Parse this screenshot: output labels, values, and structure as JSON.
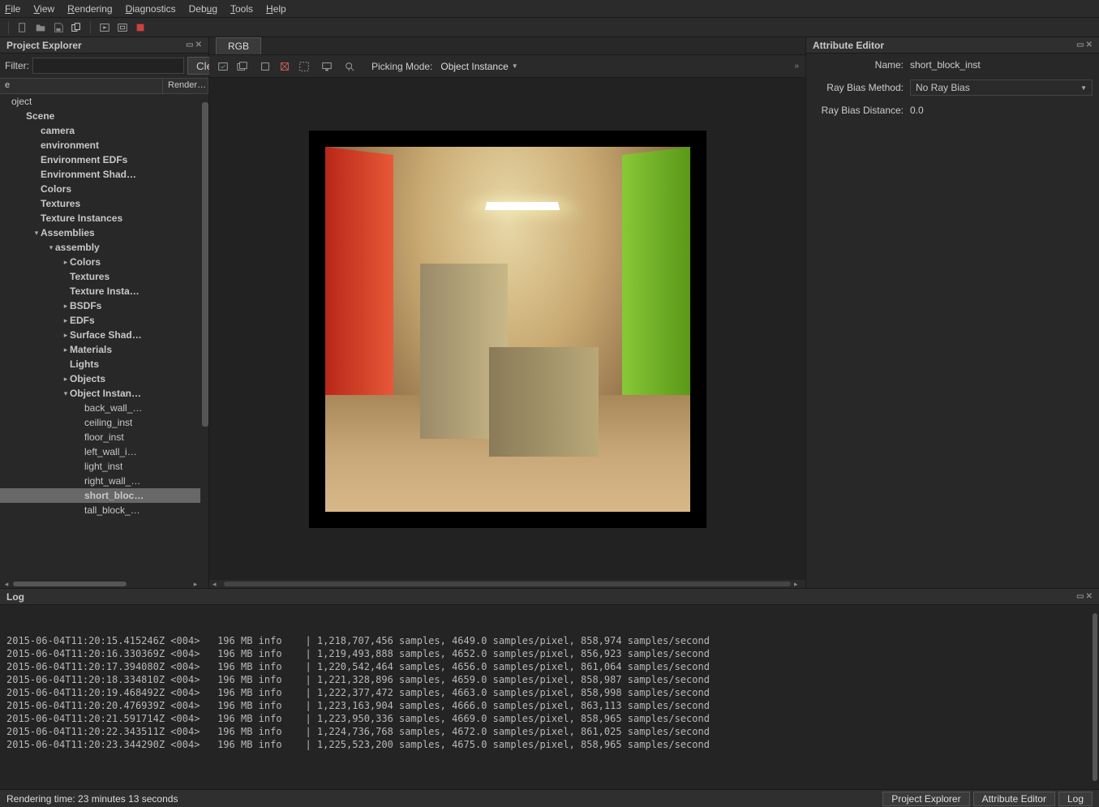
{
  "menu": {
    "items": [
      "File",
      "View",
      "Rendering",
      "Diagnostics",
      "Debug",
      "Tools",
      "Help"
    ]
  },
  "toolbar1": {
    "icons": [
      "new-file",
      "open-folder",
      "save",
      "duplicate",
      "play",
      "play-region",
      "stop-square"
    ]
  },
  "projectExplorer": {
    "title": "Project Explorer",
    "filterLabel": "Filter:",
    "clearLabel": "Clear",
    "columns": [
      "e",
      "Render…"
    ],
    "tree": [
      {
        "depth": 0,
        "arrow": "",
        "bold": false,
        "label": "oject"
      },
      {
        "depth": 1,
        "arrow": "",
        "bold": true,
        "label": "Scene"
      },
      {
        "depth": 2,
        "arrow": "",
        "bold": true,
        "label": "camera"
      },
      {
        "depth": 2,
        "arrow": "",
        "bold": true,
        "label": "environment"
      },
      {
        "depth": 2,
        "arrow": "",
        "bold": true,
        "label": "Environment EDFs"
      },
      {
        "depth": 2,
        "arrow": "",
        "bold": true,
        "label": "Environment Shad…"
      },
      {
        "depth": 2,
        "arrow": "",
        "bold": true,
        "label": "Colors"
      },
      {
        "depth": 2,
        "arrow": "",
        "bold": true,
        "label": "Textures"
      },
      {
        "depth": 2,
        "arrow": "",
        "bold": true,
        "label": "Texture Instances"
      },
      {
        "depth": 2,
        "arrow": "▾",
        "bold": true,
        "label": "Assemblies"
      },
      {
        "depth": 3,
        "arrow": "▾",
        "bold": true,
        "label": "assembly"
      },
      {
        "depth": 4,
        "arrow": "▸",
        "bold": true,
        "label": "Colors"
      },
      {
        "depth": 4,
        "arrow": "",
        "bold": true,
        "label": "Textures"
      },
      {
        "depth": 4,
        "arrow": "",
        "bold": true,
        "label": "Texture Insta…"
      },
      {
        "depth": 4,
        "arrow": "▸",
        "bold": true,
        "label": "BSDFs"
      },
      {
        "depth": 4,
        "arrow": "▸",
        "bold": true,
        "label": "EDFs"
      },
      {
        "depth": 4,
        "arrow": "▸",
        "bold": true,
        "label": "Surface Shad…"
      },
      {
        "depth": 4,
        "arrow": "▸",
        "bold": true,
        "label": "Materials"
      },
      {
        "depth": 4,
        "arrow": "",
        "bold": true,
        "label": "Lights"
      },
      {
        "depth": 4,
        "arrow": "▸",
        "bold": true,
        "label": "Objects"
      },
      {
        "depth": 4,
        "arrow": "▾",
        "bold": true,
        "label": "Object Instan…"
      },
      {
        "depth": 5,
        "arrow": "",
        "bold": false,
        "label": "back_wall_…"
      },
      {
        "depth": 5,
        "arrow": "",
        "bold": false,
        "label": "ceiling_inst"
      },
      {
        "depth": 5,
        "arrow": "",
        "bold": false,
        "label": "floor_inst"
      },
      {
        "depth": 5,
        "arrow": "",
        "bold": false,
        "label": "left_wall_i…"
      },
      {
        "depth": 5,
        "arrow": "",
        "bold": false,
        "label": "light_inst"
      },
      {
        "depth": 5,
        "arrow": "",
        "bold": false,
        "label": "right_wall_…"
      },
      {
        "depth": 5,
        "arrow": "",
        "bold": false,
        "label": "short_bloc…",
        "selected": true
      },
      {
        "depth": 5,
        "arrow": "",
        "bold": false,
        "label": "tall_block_…"
      }
    ]
  },
  "viewport": {
    "tab": "RGB",
    "pickingModeLabel": "Picking Mode:",
    "pickingModeValue": "Object Instance"
  },
  "attributeEditor": {
    "title": "Attribute Editor",
    "rows": [
      {
        "label": "Name:",
        "value": "short_block_inst",
        "type": "text"
      },
      {
        "label": "Ray Bias Method:",
        "value": "No Ray Bias",
        "type": "select"
      },
      {
        "label": "Ray Bias Distance:",
        "value": "0.0",
        "type": "text"
      }
    ]
  },
  "log": {
    "title": "Log",
    "lines": [
      "2015-06-04T11:20:15.415246Z <004>   196 MB info    | 1,218,707,456 samples, 4649.0 samples/pixel, 858,974 samples/second",
      "2015-06-04T11:20:16.330369Z <004>   196 MB info    | 1,219,493,888 samples, 4652.0 samples/pixel, 856,923 samples/second",
      "2015-06-04T11:20:17.394080Z <004>   196 MB info    | 1,220,542,464 samples, 4656.0 samples/pixel, 861,064 samples/second",
      "2015-06-04T11:20:18.334810Z <004>   196 MB info    | 1,221,328,896 samples, 4659.0 samples/pixel, 858,987 samples/second",
      "2015-06-04T11:20:19.468492Z <004>   196 MB info    | 1,222,377,472 samples, 4663.0 samples/pixel, 858,998 samples/second",
      "2015-06-04T11:20:20.476939Z <004>   196 MB info    | 1,223,163,904 samples, 4666.0 samples/pixel, 863,113 samples/second",
      "2015-06-04T11:20:21.591714Z <004>   196 MB info    | 1,223,950,336 samples, 4669.0 samples/pixel, 858,965 samples/second",
      "2015-06-04T11:20:22.343511Z <004>   196 MB info    | 1,224,736,768 samples, 4672.0 samples/pixel, 861,025 samples/second",
      "2015-06-04T11:20:23.344290Z <004>   196 MB info    | 1,225,523,200 samples, 4675.0 samples/pixel, 858,965 samples/second"
    ]
  },
  "status": {
    "renderingTime": "Rendering time: 23 minutes 13 seconds",
    "buttons": [
      "Project Explorer",
      "Attribute Editor",
      "Log"
    ]
  }
}
